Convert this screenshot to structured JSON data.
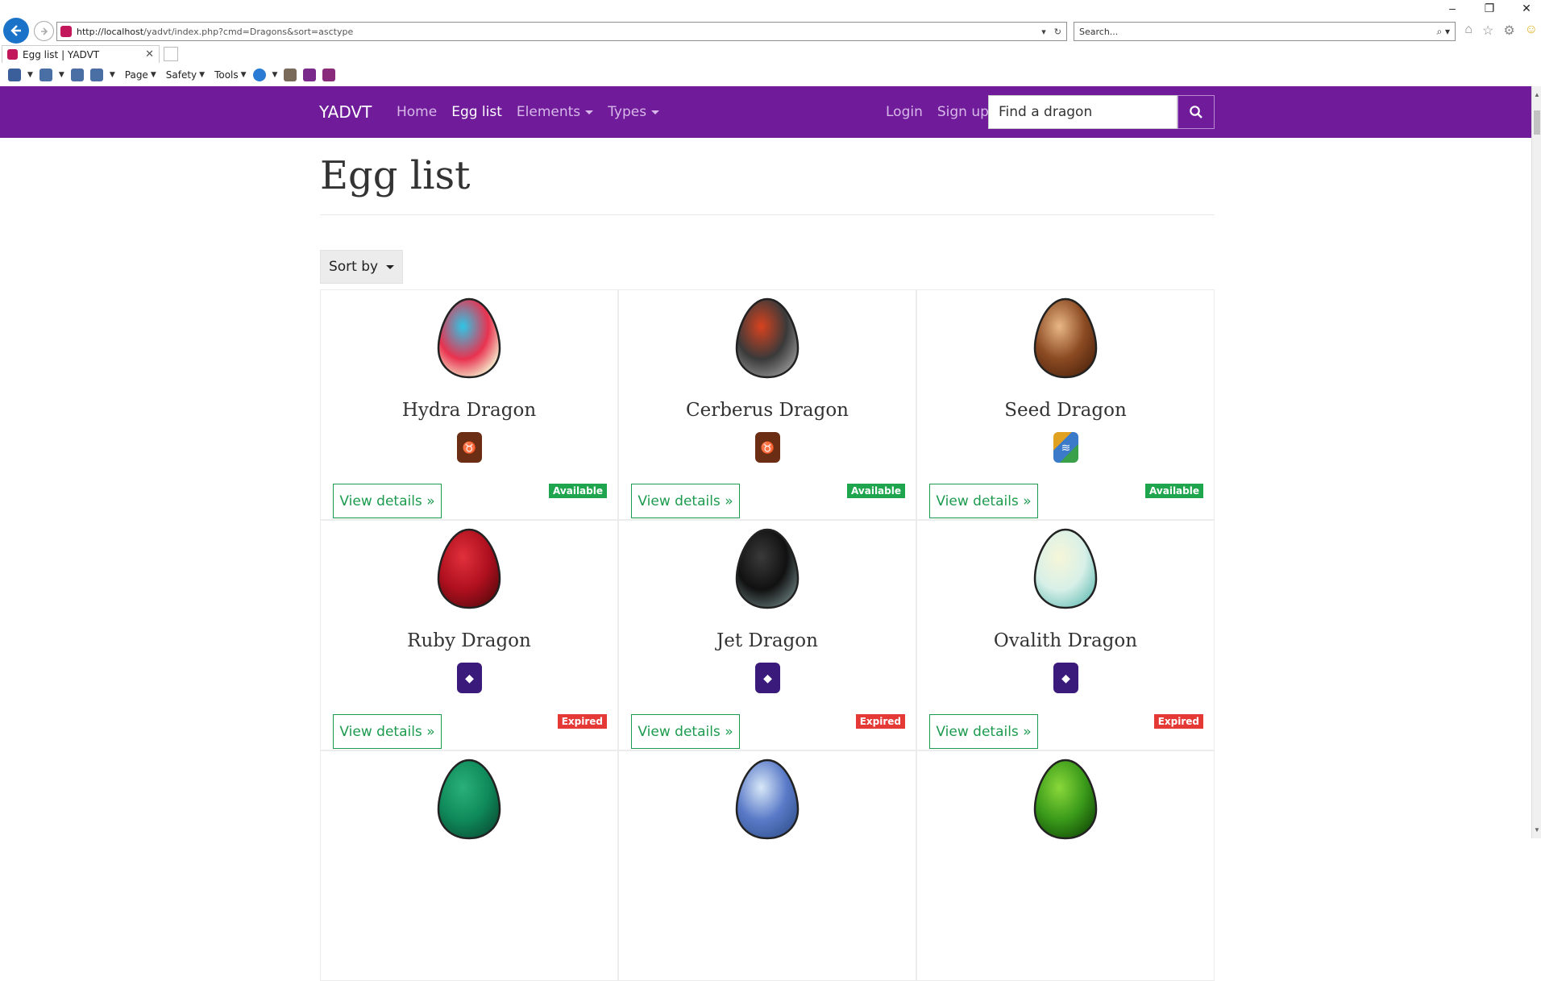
{
  "browser": {
    "url_host": "http://localhost",
    "url_path": "/yadvt/index.php?cmd=Dragons&sort=asctype",
    "search_placeholder": "Search...",
    "tab_title": "Egg list | YADVT",
    "cmd_page": "Page",
    "cmd_safety": "Safety",
    "cmd_tools": "Tools"
  },
  "navbar": {
    "brand": "YADVT",
    "home": "Home",
    "egg_list": "Egg list",
    "elements": "Elements",
    "types": "Types",
    "login": "Login",
    "signup": "Sign up",
    "find_placeholder": "Find a dragon"
  },
  "page": {
    "title": "Egg list",
    "sort_label": "Sort by"
  },
  "cards": [
    {
      "name": "Hydra Dragon",
      "view": "View details »",
      "status": "Available",
      "status_color": "#1fa54d",
      "element": "brown",
      "egg": [
        "#e9324f",
        "#2ec6e6",
        "#f3e6c8"
      ]
    },
    {
      "name": "Cerberus Dragon",
      "view": "View details »",
      "status": "Available",
      "status_color": "#1fa54d",
      "element": "brown",
      "egg": [
        "#3a3a3a",
        "#d8421e",
        "#8a8a8a"
      ]
    },
    {
      "name": "Seed Dragon",
      "view": "View details »",
      "status": "Available",
      "status_color": "#1fa54d",
      "element": "multi",
      "egg": [
        "#8b4a22",
        "#e9b785",
        "#5a2c12"
      ]
    },
    {
      "name": "Ruby Dragon",
      "view": "View details »",
      "status": "Expired",
      "status_color": "#e53935",
      "element": "purple",
      "egg": [
        "#b0101f",
        "#e0303b",
        "#6b0a10"
      ]
    },
    {
      "name": "Jet Dragon",
      "view": "View details »",
      "status": "Expired",
      "status_color": "#e53935",
      "element": "purple",
      "egg": [
        "#111111",
        "#3a3a3a",
        "#5a6a6a"
      ]
    },
    {
      "name": "Ovalith Dragon",
      "view": "View details »",
      "status": "Expired",
      "status_color": "#e53935",
      "element": "purple",
      "egg": [
        "#d8f0e8",
        "#f6f6d8",
        "#7ec8c0"
      ]
    },
    {
      "name": "",
      "view": "",
      "status": "",
      "status_color": "",
      "element": "",
      "egg": [
        "#0f8a5a",
        "#2ab07a",
        "#0a5a3c"
      ]
    },
    {
      "name": "",
      "view": "",
      "status": "",
      "status_color": "",
      "element": "",
      "egg": [
        "#5a7ac8",
        "#d8e8f8",
        "#3a5a9a"
      ]
    },
    {
      "name": "",
      "view": "",
      "status": "",
      "status_color": "",
      "element": "",
      "egg": [
        "#3a9a1a",
        "#8ad83a",
        "#1a5a0a"
      ]
    }
  ]
}
